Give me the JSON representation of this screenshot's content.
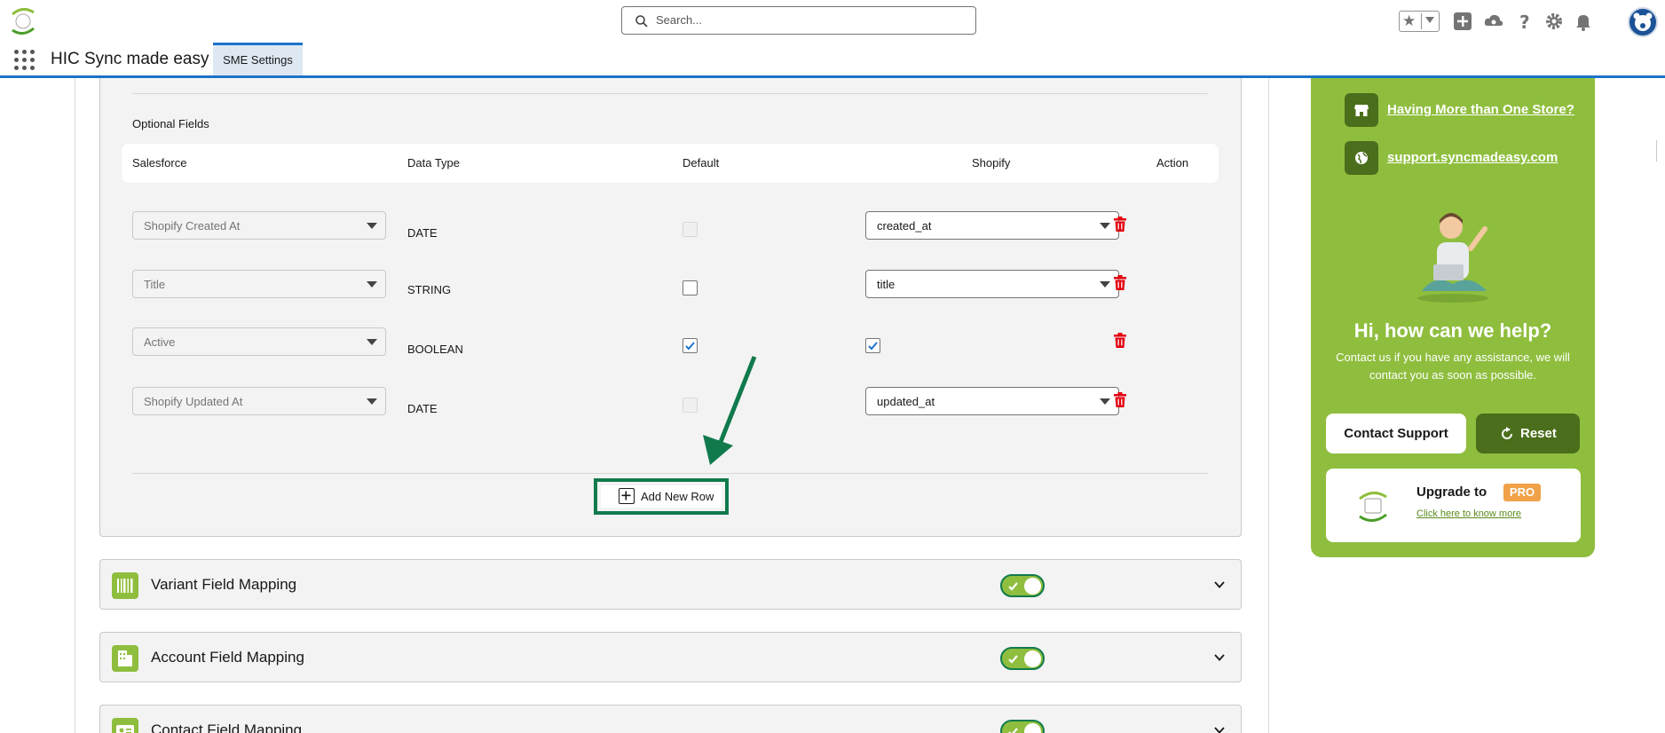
{
  "header": {
    "search_placeholder": "Search...",
    "app_name": "HIC Sync made easy",
    "tab_label": "SME Settings"
  },
  "optional_fields": {
    "section_label": "Optional Fields",
    "columns": [
      "Salesforce",
      "Data Type",
      "Default",
      "Shopify",
      "Action"
    ],
    "rows": [
      {
        "salesforce": "Shopify Created At",
        "data_type": "DATE",
        "default": "disabled",
        "shopify": "created_at",
        "shopify_kind": "select"
      },
      {
        "salesforce": "Title",
        "data_type": "STRING",
        "default": "unchecked",
        "shopify": "title",
        "shopify_kind": "select"
      },
      {
        "salesforce": "Active",
        "data_type": "BOOLEAN",
        "default": "checked",
        "shopify": "",
        "shopify_kind": "checkbox"
      },
      {
        "salesforce": "Shopify Updated At",
        "data_type": "DATE",
        "default": "disabled",
        "shopify": "updated_at",
        "shopify_kind": "select"
      }
    ],
    "add_row_label": "Add New Row"
  },
  "mappings": [
    {
      "title": "Variant Field Mapping",
      "enabled": true
    },
    {
      "title": "Account Field Mapping",
      "enabled": true
    },
    {
      "title": "Contact Field Mapping",
      "enabled": true
    }
  ],
  "help": {
    "link_stores": "Having More than One Store?",
    "link_support": "support.syncmadeasy.com",
    "title": "Hi, how can we help?",
    "subtitle": "Contact us if you have any assistance, we will contact you as soon as possible.",
    "contact_button": "Contact Support",
    "reset_button": "Reset",
    "upgrade_text": "Upgrade to",
    "upgrade_badge": "PRO",
    "upgrade_link": "Click here to know more"
  },
  "colors": {
    "brand_green": "#8fbe3e",
    "dark_green": "#4a6e1b",
    "annotation_green": "#107a4c",
    "accent_blue": "#1b73c9",
    "delete_red": "#e3000f"
  },
  "icons": {
    "search": "search-icon",
    "favorites": "star-icon",
    "add": "plus-icon",
    "trailhead": "cloud-icon",
    "help": "question-icon",
    "setup": "gear-icon",
    "notifications": "bell-icon",
    "delete": "trash-icon",
    "store": "store-icon",
    "globe": "globe-icon",
    "reset": "refresh-icon",
    "expand": "chevron-down-icon"
  }
}
